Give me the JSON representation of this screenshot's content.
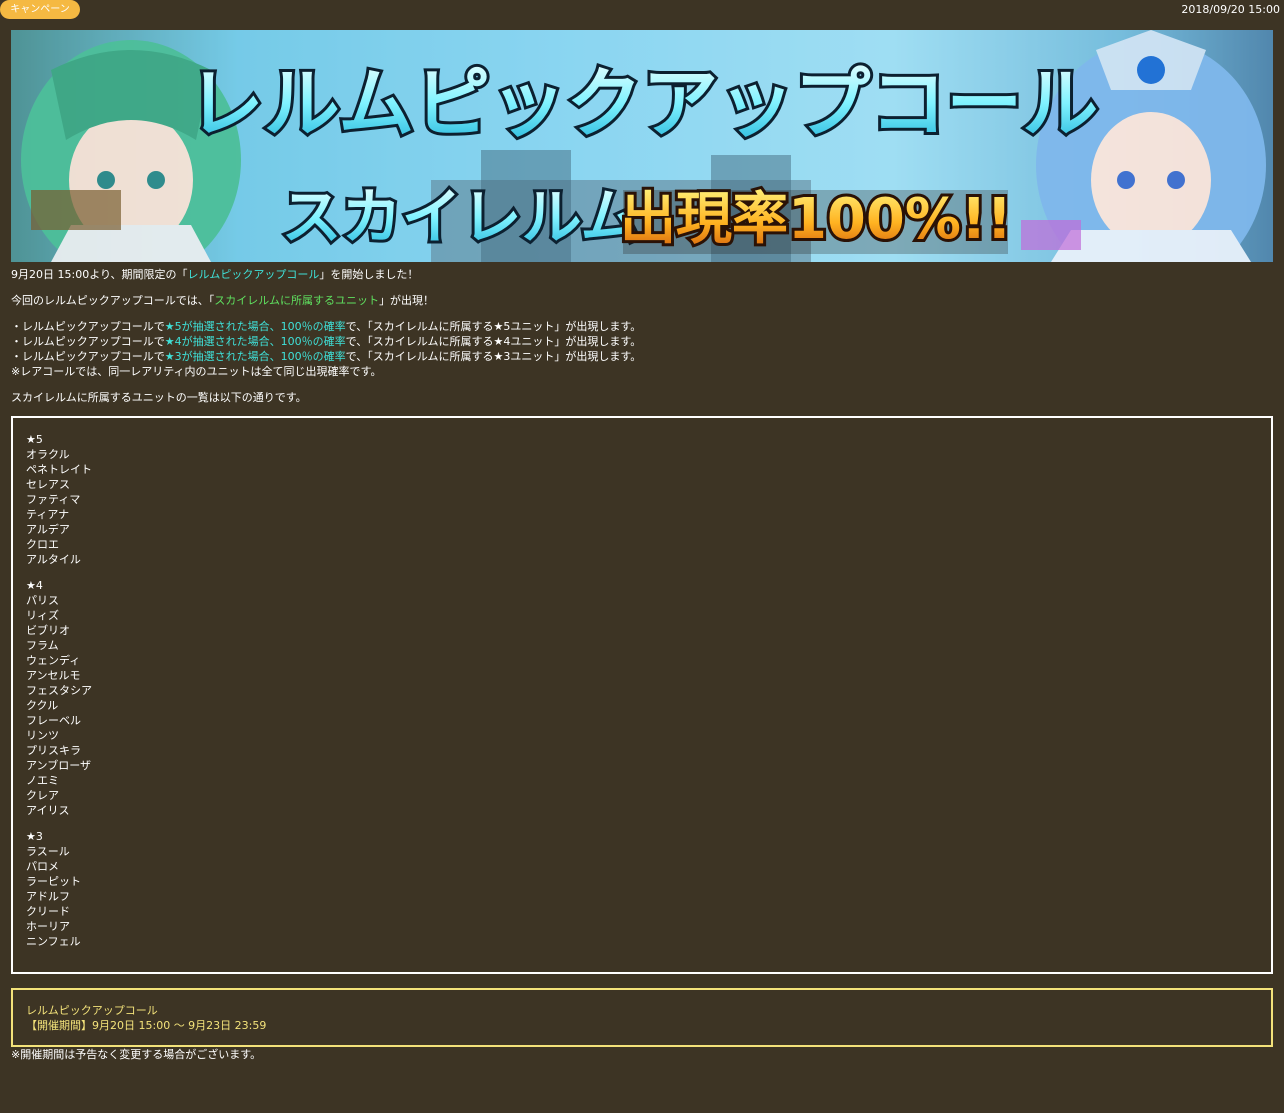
{
  "header": {
    "category": "キャンペーン",
    "date": "2018/09/20 15:00"
  },
  "banner": {
    "title": "レルムピックアップコール",
    "subtitle_left": "スカイレルム",
    "subtitle_right": "出現率100%!!"
  },
  "intro": {
    "p1_before": "9月20日 15:00より、期間限定の「",
    "p1_link": "レルムピックアップコール",
    "p1_after": "」を開始しました！",
    "p2_before": "今回のレルムピックアップコールでは、「",
    "p2_highlight": "スカイレルムに所属するユニット",
    "p2_after": "」が出現！"
  },
  "rates": [
    {
      "before": "・レルムピックアップコールで",
      "highlight": "★5が抽選された場合、100％の確率",
      "after": "で、「スカイレルムに所属する★5ユニット」が出現します。"
    },
    {
      "before": "・レルムピックアップコールで",
      "highlight": "★4が抽選された場合、100％の確率",
      "after": "で、「スカイレルムに所属する★4ユニット」が出現します。"
    },
    {
      "before": "・レルムピックアップコールで",
      "highlight": "★3が抽選された場合、100％の確率",
      "after": "で、「スカイレルムに所属する★3ユニット」が出現します。"
    }
  ],
  "rare_note": "※レアコールでは、同一レアリティ内のユニットは全て同じ出現確率です。",
  "list_intro": "スカイレルムに所属するユニットの一覧は以下の通りです。",
  "units": {
    "star5": {
      "heading": "★5",
      "names": [
        "オラクル",
        "ペネトレイト",
        "セレアス",
        "ファティマ",
        "ティアナ",
        "アルデア",
        "クロエ",
        "アルタイル"
      ]
    },
    "star4": {
      "heading": "★4",
      "names": [
        "パリス",
        "リィズ",
        "ビブリオ",
        "フラム",
        "ウェンディ",
        "アンセルモ",
        "フェスタシア",
        "ククル",
        "フレーベル",
        "リンツ",
        "プリスキラ",
        "アンブローザ",
        "ノエミ",
        "クレア",
        "アイリス"
      ]
    },
    "star3": {
      "heading": "★3",
      "names": [
        "ラスール",
        "パロメ",
        "ラーピット",
        "アドルフ",
        "クリード",
        "ホーリア",
        "ニンフェル"
      ]
    }
  },
  "period": {
    "title": "レルムピックアップコール",
    "dates": "【開催期間】9月20日 15:00 ～ 9月23日 23:59"
  },
  "footnote": "※開催期間は予告なく変更する場合がございます。",
  "colors": {
    "background": "#3d3424",
    "badge": "#f5b942",
    "highlight_cyan": "#3fe0d8",
    "highlight_green": "#5fe05f",
    "period_yellow": "#f3e27a"
  }
}
